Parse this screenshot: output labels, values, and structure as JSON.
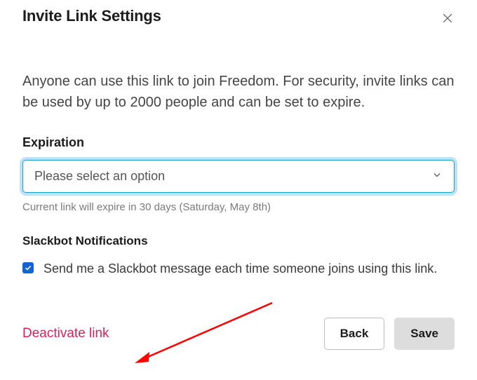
{
  "dialog": {
    "title": "Invite Link Settings",
    "description": "Anyone can use this link to join Freedom. For security, invite links can be used by up to 2000 people and can be set to expire."
  },
  "expiration": {
    "label": "Expiration",
    "placeholder": "Please select an option",
    "helper": "Current link will expire in 30 days (Saturday, May 8th)"
  },
  "notifications": {
    "heading": "Slackbot Notifications",
    "checkbox_label": "Send me a Slackbot message each time someone joins using this link.",
    "checked": true
  },
  "footer": {
    "deactivate": "Deactivate link",
    "back": "Back",
    "save": "Save"
  },
  "colors": {
    "danger": "#e01e5a",
    "focus_ring": "#bde4f6",
    "checkbox": "#1264d3"
  },
  "annotation": {
    "arrow_color": "#ff0000"
  }
}
